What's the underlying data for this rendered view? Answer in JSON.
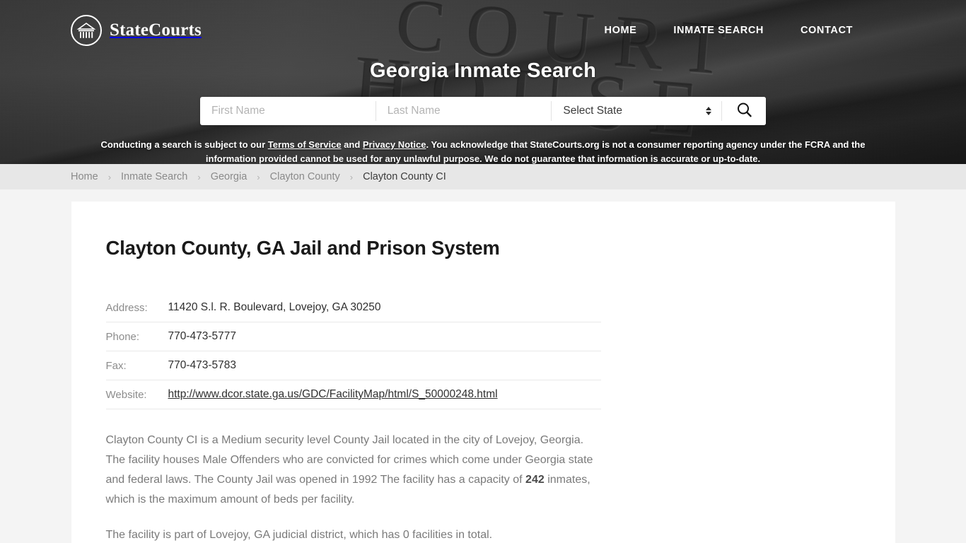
{
  "header": {
    "brand_name": "StateCourts",
    "logo_icon": "courthouse-circle-icon",
    "nav": [
      {
        "label": "HOME",
        "name": "nav-home"
      },
      {
        "label": "INMATE SEARCH",
        "name": "nav-inmate-search"
      },
      {
        "label": "CONTACT",
        "name": "nav-contact"
      }
    ],
    "hero_title": "Georgia Inmate Search",
    "background_text_line1": "COURT",
    "background_text_line2": "HOUSE"
  },
  "search": {
    "first_name_placeholder": "First Name",
    "first_name_value": "",
    "last_name_placeholder": "Last Name",
    "last_name_value": "",
    "state_selected": "Select State",
    "search_icon": "magnifier-icon",
    "spinner_icon": "chevron-up-down-icon"
  },
  "disclaimer": {
    "part1": "Conducting a search is subject to our ",
    "link1": "Terms of Service",
    "part2": " and ",
    "link2": "Privacy Notice",
    "part3": ". You acknowledge that StateCourts.org is not a consumer reporting agency under the FCRA and the information provided cannot be used for any unlawful purpose. We do not guarantee that information is accurate or up-to-date."
  },
  "breadcrumb": {
    "separator": "›",
    "items": [
      {
        "label": "Home",
        "active": false
      },
      {
        "label": "Inmate Search",
        "active": false
      },
      {
        "label": "Georgia",
        "active": false
      },
      {
        "label": "Clayton County",
        "active": false
      },
      {
        "label": "Clayton County CI",
        "active": true
      }
    ]
  },
  "main": {
    "title": "Clayton County, GA Jail and Prison System",
    "info_rows": [
      {
        "label": "Address:",
        "value": "11420 S.l. R. Boulevard, Lovejoy, GA 30250",
        "is_link": false
      },
      {
        "label": "Phone:",
        "value": "770-473-5777",
        "is_link": false
      },
      {
        "label": "Fax:",
        "value": "770-473-5783",
        "is_link": false
      },
      {
        "label": "Website:",
        "value": "http://www.dcor.state.ga.us/GDC/FacilityMap/html/S_50000248.html",
        "is_link": true
      }
    ],
    "paragraph1_a": "Clayton County CI is a Medium security level County Jail located in the city of Lovejoy, Georgia. The facility houses Male Offenders who are convicted for crimes which come under Georgia state and federal laws. The County Jail was opened in 1992 The facility has a capacity of ",
    "paragraph1_bold": "242",
    "paragraph1_b": " inmates, which is the maximum amount of beds per facility.",
    "paragraph2": "The facility is part of Lovejoy, GA judicial district, which has 0 facilities in total."
  },
  "colors": {
    "header_dark": "#4a4a4a",
    "breadcrumb_bar": "#e7e7e7",
    "page_bg": "#f4f4f4",
    "card_bg": "#ffffff",
    "text_muted": "#8a8a8a",
    "text_dark": "#1a1a1a"
  }
}
